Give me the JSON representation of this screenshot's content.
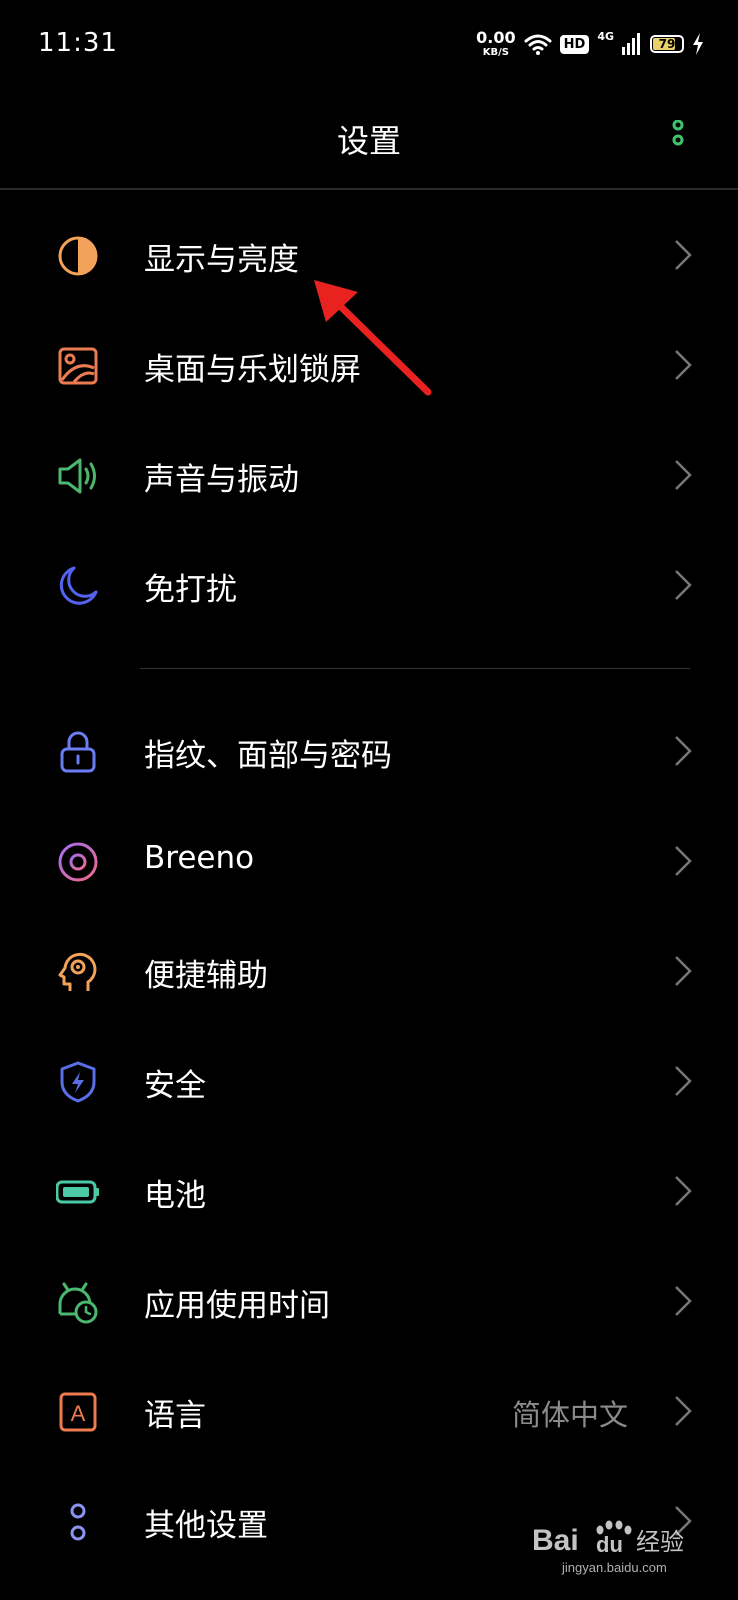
{
  "status": {
    "time": "11:31",
    "net_speed": "0.00",
    "net_unit": "KB/S",
    "hd": "HD",
    "signal_type": "4G",
    "battery_percent": 79,
    "battery_label": "79",
    "charging": true,
    "battery_color": "#e9d26c"
  },
  "header": {
    "title": "设置",
    "more_icon": "more-vertical-icon",
    "accent": "#3ec46d"
  },
  "groups": [
    {
      "items": [
        {
          "label": "显示与亮度",
          "icon": "display-brightness-icon",
          "color": "#f2a25a"
        },
        {
          "label": "桌面与乐划锁屏",
          "icon": "wallpaper-icon",
          "color": "#ec7b52"
        },
        {
          "label": "声音与振动",
          "icon": "speaker-icon",
          "color": "#4bb86f"
        },
        {
          "label": "免打扰",
          "icon": "moon-icon",
          "color": "#5563f0"
        }
      ]
    },
    {
      "items": [
        {
          "label": "指纹、面部与密码",
          "icon": "lock-icon",
          "color": "#6b7df2"
        },
        {
          "label": "Breeno",
          "icon": "breeno-icon",
          "color": "#d55ec8"
        },
        {
          "label": "便捷辅助",
          "icon": "head-assist-icon",
          "color": "#f2a25a"
        },
        {
          "label": "安全",
          "icon": "shield-icon",
          "color": "#5a6fe6"
        },
        {
          "label": "电池",
          "icon": "battery-icon",
          "color": "#4cc9a5"
        },
        {
          "label": "应用使用时间",
          "icon": "app-usage-time-icon",
          "color": "#4bb86f"
        },
        {
          "label": "语言",
          "icon": "language-icon",
          "color": "#ec7b52",
          "icon_text": "A",
          "value": "简体中文"
        },
        {
          "label": "其他设置",
          "icon": "more-settings-icon",
          "color": "#8a93f0"
        }
      ]
    }
  ],
  "watermark": {
    "brand": "Bai",
    "brand2": "du",
    "suffix": "经验",
    "url": "jingyan.baidu.com"
  },
  "annotation_color": "#e8231f"
}
